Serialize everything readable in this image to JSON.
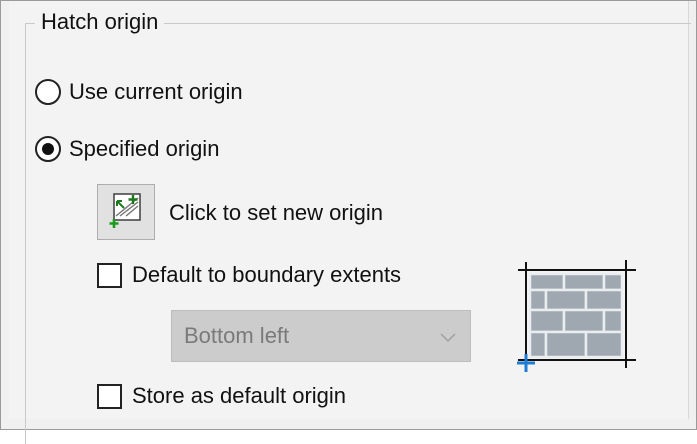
{
  "group": {
    "title": "Hatch origin"
  },
  "options": {
    "use_current": {
      "label": "Use current origin",
      "selected": false
    },
    "specified": {
      "label": "Specified origin",
      "selected": true
    }
  },
  "set_origin": {
    "label": "Click to set new origin",
    "icon": "set-origin-icon"
  },
  "default_extents": {
    "label": "Default to boundary extents",
    "checked": false
  },
  "position_select": {
    "value": "Bottom left",
    "enabled": false
  },
  "store_default": {
    "label": "Store as default origin",
    "checked": false
  },
  "preview": {
    "icon": "hatch-preview-icon",
    "marker_color": "#1e7bd6"
  }
}
